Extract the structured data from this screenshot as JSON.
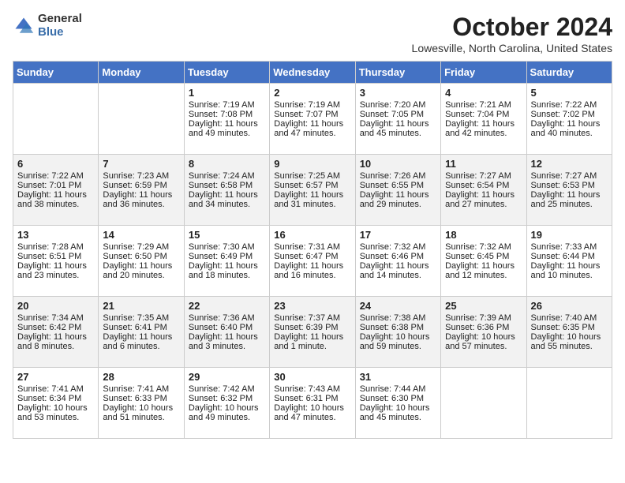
{
  "header": {
    "logo": {
      "general": "General",
      "blue": "Blue"
    },
    "title": "October 2024",
    "subtitle": "Lowesville, North Carolina, United States"
  },
  "days_of_week": [
    "Sunday",
    "Monday",
    "Tuesday",
    "Wednesday",
    "Thursday",
    "Friday",
    "Saturday"
  ],
  "weeks": [
    [
      {
        "day": "",
        "info": ""
      },
      {
        "day": "",
        "info": ""
      },
      {
        "day": "1",
        "info": "Sunrise: 7:19 AM\nSunset: 7:08 PM\nDaylight: 11 hours and 49 minutes."
      },
      {
        "day": "2",
        "info": "Sunrise: 7:19 AM\nSunset: 7:07 PM\nDaylight: 11 hours and 47 minutes."
      },
      {
        "day": "3",
        "info": "Sunrise: 7:20 AM\nSunset: 7:05 PM\nDaylight: 11 hours and 45 minutes."
      },
      {
        "day": "4",
        "info": "Sunrise: 7:21 AM\nSunset: 7:04 PM\nDaylight: 11 hours and 42 minutes."
      },
      {
        "day": "5",
        "info": "Sunrise: 7:22 AM\nSunset: 7:02 PM\nDaylight: 11 hours and 40 minutes."
      }
    ],
    [
      {
        "day": "6",
        "info": "Sunrise: 7:22 AM\nSunset: 7:01 PM\nDaylight: 11 hours and 38 minutes."
      },
      {
        "day": "7",
        "info": "Sunrise: 7:23 AM\nSunset: 6:59 PM\nDaylight: 11 hours and 36 minutes."
      },
      {
        "day": "8",
        "info": "Sunrise: 7:24 AM\nSunset: 6:58 PM\nDaylight: 11 hours and 34 minutes."
      },
      {
        "day": "9",
        "info": "Sunrise: 7:25 AM\nSunset: 6:57 PM\nDaylight: 11 hours and 31 minutes."
      },
      {
        "day": "10",
        "info": "Sunrise: 7:26 AM\nSunset: 6:55 PM\nDaylight: 11 hours and 29 minutes."
      },
      {
        "day": "11",
        "info": "Sunrise: 7:27 AM\nSunset: 6:54 PM\nDaylight: 11 hours and 27 minutes."
      },
      {
        "day": "12",
        "info": "Sunrise: 7:27 AM\nSunset: 6:53 PM\nDaylight: 11 hours and 25 minutes."
      }
    ],
    [
      {
        "day": "13",
        "info": "Sunrise: 7:28 AM\nSunset: 6:51 PM\nDaylight: 11 hours and 23 minutes."
      },
      {
        "day": "14",
        "info": "Sunrise: 7:29 AM\nSunset: 6:50 PM\nDaylight: 11 hours and 20 minutes."
      },
      {
        "day": "15",
        "info": "Sunrise: 7:30 AM\nSunset: 6:49 PM\nDaylight: 11 hours and 18 minutes."
      },
      {
        "day": "16",
        "info": "Sunrise: 7:31 AM\nSunset: 6:47 PM\nDaylight: 11 hours and 16 minutes."
      },
      {
        "day": "17",
        "info": "Sunrise: 7:32 AM\nSunset: 6:46 PM\nDaylight: 11 hours and 14 minutes."
      },
      {
        "day": "18",
        "info": "Sunrise: 7:32 AM\nSunset: 6:45 PM\nDaylight: 11 hours and 12 minutes."
      },
      {
        "day": "19",
        "info": "Sunrise: 7:33 AM\nSunset: 6:44 PM\nDaylight: 11 hours and 10 minutes."
      }
    ],
    [
      {
        "day": "20",
        "info": "Sunrise: 7:34 AM\nSunset: 6:42 PM\nDaylight: 11 hours and 8 minutes."
      },
      {
        "day": "21",
        "info": "Sunrise: 7:35 AM\nSunset: 6:41 PM\nDaylight: 11 hours and 6 minutes."
      },
      {
        "day": "22",
        "info": "Sunrise: 7:36 AM\nSunset: 6:40 PM\nDaylight: 11 hours and 3 minutes."
      },
      {
        "day": "23",
        "info": "Sunrise: 7:37 AM\nSunset: 6:39 PM\nDaylight: 11 hours and 1 minute."
      },
      {
        "day": "24",
        "info": "Sunrise: 7:38 AM\nSunset: 6:38 PM\nDaylight: 10 hours and 59 minutes."
      },
      {
        "day": "25",
        "info": "Sunrise: 7:39 AM\nSunset: 6:36 PM\nDaylight: 10 hours and 57 minutes."
      },
      {
        "day": "26",
        "info": "Sunrise: 7:40 AM\nSunset: 6:35 PM\nDaylight: 10 hours and 55 minutes."
      }
    ],
    [
      {
        "day": "27",
        "info": "Sunrise: 7:41 AM\nSunset: 6:34 PM\nDaylight: 10 hours and 53 minutes."
      },
      {
        "day": "28",
        "info": "Sunrise: 7:41 AM\nSunset: 6:33 PM\nDaylight: 10 hours and 51 minutes."
      },
      {
        "day": "29",
        "info": "Sunrise: 7:42 AM\nSunset: 6:32 PM\nDaylight: 10 hours and 49 minutes."
      },
      {
        "day": "30",
        "info": "Sunrise: 7:43 AM\nSunset: 6:31 PM\nDaylight: 10 hours and 47 minutes."
      },
      {
        "day": "31",
        "info": "Sunrise: 7:44 AM\nSunset: 6:30 PM\nDaylight: 10 hours and 45 minutes."
      },
      {
        "day": "",
        "info": ""
      },
      {
        "day": "",
        "info": ""
      }
    ]
  ]
}
